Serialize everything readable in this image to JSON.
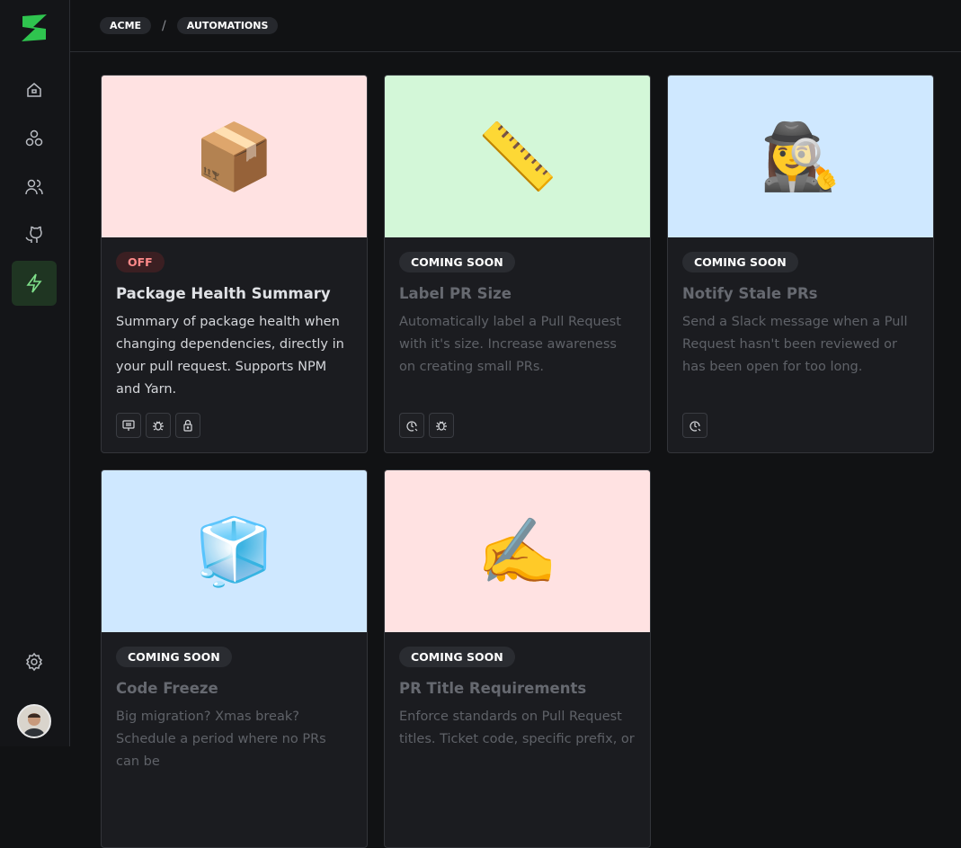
{
  "breadcrumb": [
    "ACME",
    "AUTOMATIONS"
  ],
  "breadcrumb_separator": "/",
  "sidebar": {
    "items": [
      {
        "name": "home",
        "icon": "home-icon"
      },
      {
        "name": "packages",
        "icon": "circles-icon"
      },
      {
        "name": "users",
        "icon": "users-icon"
      },
      {
        "name": "github",
        "icon": "github-icon"
      },
      {
        "name": "automations",
        "icon": "lightning-icon",
        "active": true
      }
    ],
    "settings_icon": "gear-icon"
  },
  "colors": {
    "accent": "#2fc44f",
    "active_bg": "#1f3522"
  },
  "cards": [
    {
      "badge": "OFF",
      "title": "Package Health Summary",
      "desc": "Summary of package health when changing dependencies, directly in your pull request. Supports NPM and Yarn.",
      "bg": "#ffe2e2",
      "emoji": "📦",
      "tags": [
        "monitor-icon",
        "bug-icon",
        "lock-icon"
      ]
    },
    {
      "badge": "COMING SOON",
      "title": "Label PR Size",
      "desc": "Automatically label a Pull Request with it's size. Increase awareness on creating small PRs.",
      "bg": "#d3f7d8",
      "emoji": "📏",
      "tags": [
        "clock-icon",
        "bug-icon"
      ]
    },
    {
      "badge": "COMING SOON",
      "title": "Notify Stale PRs",
      "desc": "Send a Slack message when a Pull Request hasn't been reviewed or has been open for too long.",
      "bg": "#cfe8ff",
      "emoji": "🕵️‍♀️",
      "tags": [
        "clock-icon"
      ]
    },
    {
      "badge": "COMING SOON",
      "title": "Code Freeze",
      "desc": "Big migration? Xmas break? Schedule a period where no PRs can be",
      "bg": "#cfe8ff",
      "emoji": "🧊",
      "tags": []
    },
    {
      "badge": "COMING SOON",
      "title": "PR Title Requirements",
      "desc": "Enforce standards on Pull Request titles. Ticket code, specific prefix, or",
      "bg": "#ffe2e2",
      "emoji": "✍️",
      "tags": []
    }
  ]
}
